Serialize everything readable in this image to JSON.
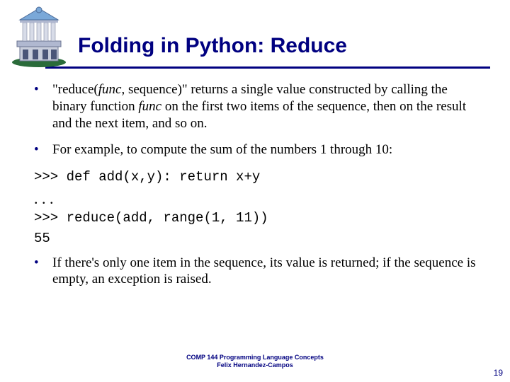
{
  "title": "Folding in Python: Reduce",
  "bullets": {
    "b1_pre": "\"reduce(",
    "b1_func1": "func",
    "b1_mid1": ", sequence)\" returns a single value constructed by calling the binary function ",
    "b1_func2": "func",
    "b1_mid2": " on the first two items of the sequence, then on the result and the next item, and so on.",
    "b2": "For example, to compute the sum of the numbers 1 through 10:",
    "b3": "If there's only one item in the sequence, its value is returned; if the sequence is empty, an exception is raised."
  },
  "code": {
    "line1": ">>> def add(x,y): return x+y",
    "ellipsis": ". . .",
    "line2": ">>> reduce(add, range(1, 11))",
    "result": "55"
  },
  "footer": {
    "line1": "COMP 144 Programming Language Concepts",
    "line2": "Felix Hernandez-Campos"
  },
  "page_number": "19"
}
